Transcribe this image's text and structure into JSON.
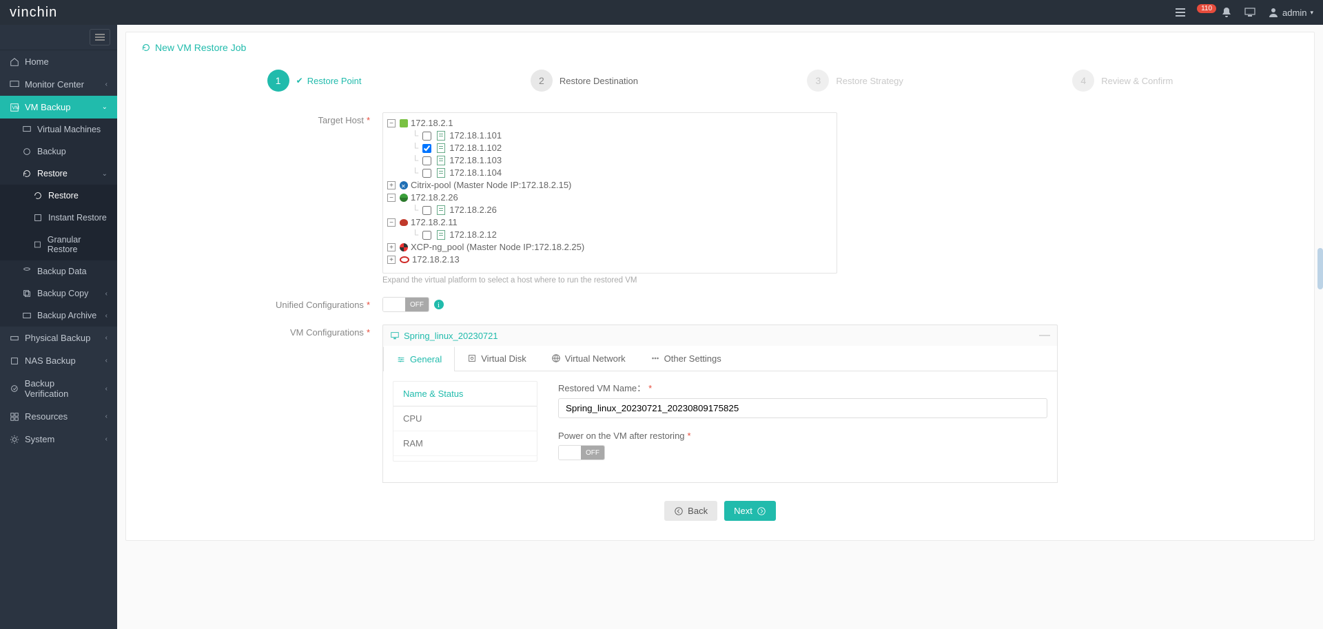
{
  "header": {
    "logo": "vinchin",
    "notif_count": "110",
    "user": "admin"
  },
  "sidebar": {
    "items": [
      {
        "label": "Home"
      },
      {
        "label": "Monitor Center"
      },
      {
        "label": "VM Backup"
      },
      {
        "label": "Virtual Machines"
      },
      {
        "label": "Backup"
      },
      {
        "label": "Restore"
      },
      {
        "label": "Restore"
      },
      {
        "label": "Instant Restore"
      },
      {
        "label": "Granular Restore"
      },
      {
        "label": "Backup Data"
      },
      {
        "label": "Backup Copy"
      },
      {
        "label": "Backup Archive"
      },
      {
        "label": "Physical Backup"
      },
      {
        "label": "NAS Backup"
      },
      {
        "label": "Backup Verification"
      },
      {
        "label": "Resources"
      },
      {
        "label": "System"
      }
    ]
  },
  "panel": {
    "title": "New VM Restore Job",
    "steps": [
      {
        "num": "1",
        "label": "Restore Point"
      },
      {
        "num": "2",
        "label": "Restore Destination"
      },
      {
        "num": "3",
        "label": "Restore Strategy"
      },
      {
        "num": "4",
        "label": "Review & Confirm"
      }
    ],
    "labels": {
      "target_host": "Target Host",
      "unified": "Unified Configurations",
      "vmconf": "VM Configurations"
    },
    "tree_hint": "Expand the virtual platform to select a host where to run the restored VM",
    "tree": {
      "n1": "172.18.2.1",
      "n1c": [
        "172.18.1.101",
        "172.18.1.102",
        "172.18.1.103",
        "172.18.1.104"
      ],
      "n2": "Citrix-pool (Master Node IP:172.18.2.15)",
      "n3": "172.18.2.26",
      "n3c": [
        "172.18.2.26"
      ],
      "n4": "172.18.2.11",
      "n4c": [
        "172.18.2.12"
      ],
      "n5": "XCP-ng_pool (Master Node IP:172.18.2.25)",
      "n6": "172.18.2.13"
    },
    "switch_off": "Off",
    "switch_off2": "OFF",
    "vm": {
      "name": "Spring_linux_20230721",
      "tabs": [
        "General",
        "Virtual Disk",
        "Virtual Network",
        "Other Settings"
      ],
      "side": [
        "Name & Status",
        "CPU",
        "RAM"
      ],
      "restored_label": "Restored VM Name：",
      "restored_value": "Spring_linux_20230721_20230809175825",
      "power_label": "Power on the VM after restoring"
    },
    "buttons": {
      "back": "Back",
      "next": "Next"
    }
  }
}
